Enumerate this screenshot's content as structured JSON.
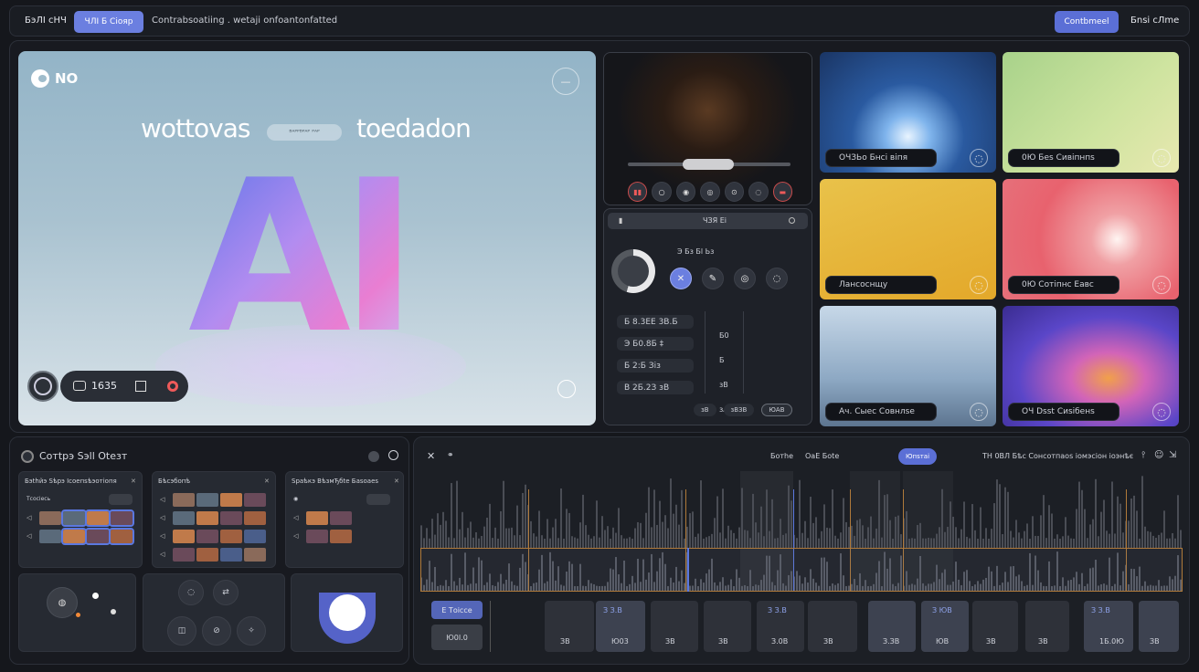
{
  "topbar": {
    "brand": "Бэ‍ЛІ сНЧ",
    "pill_label": "ЧЛІ Б Сiояр",
    "breadcrumb": "Contrabsoatiing . wetaji onfoantonfatted",
    "primary_button": "Contbmeel",
    "account_label": "Бnsi сЛmе"
  },
  "hero": {
    "logo_text": "NO",
    "heading_left": "wottovas",
    "heading_mid": "ᴮᴬᴾᴾᴮᴾᴬᴾ ᴾᴬᴾ",
    "heading_right": "toedadon",
    "big_glyph": "AI",
    "minimize_icon": "—",
    "counter": "1635",
    "colors": {
      "bg_top": "#9cb9c9",
      "bg_bottom": "#d8e2e8"
    }
  },
  "mini_player": {
    "progress": 0.38,
    "control_glyphs": [
      "▮▮",
      "○",
      "◉",
      "◎",
      "⊙",
      "◌",
      "▬"
    ]
  },
  "settings_panel": {
    "search_text": "ЧЗЯ Еі",
    "caption": "Э Бз Бl Ьз",
    "tool_glyphs": [
      "✕",
      "✎",
      "◎",
      "◌"
    ],
    "rows": [
      "Б 8.3ЕЕ 3В.Б",
      "Э Б0.8Б ‡",
      "Б 2:Б Зіз",
      "В 2Б.2З зВ"
    ],
    "side_values": [
      "Б0",
      "Б",
      "зВ",
      "зАВ"
    ],
    "footer_chips": [
      "зВ",
      "зВЗВ",
      "ЮАВ"
    ]
  },
  "tiles": [
    {
      "label": "ОЧЗЬо Бнсі віпя",
      "bg": "#1e3f74"
    },
    {
      "label": "0Ю Беs Сивіпнпs",
      "bg": "#b8d890"
    },
    {
      "label": "Лансоснщу",
      "bg": "#e4b432"
    },
    {
      "label": "0Ю Сотіпнс Еавс",
      "bg": "#e86a72"
    },
    {
      "label": "Ач. Сыес Совнлsе",
      "bg": "#9fb7d0"
    },
    {
      "label": "ОЧ Dsst Сиsiбенs",
      "bg": "#4b3ab0"
    }
  ],
  "library": {
    "title": "Сотtрэ Sэll Оtезт",
    "cards": [
      {
        "title": "Бэthйэ Sѣрэ Ісоепsѣэотіопя"
      },
      {
        "title": "Бѣсэбопѣ"
      },
      {
        "title": "Spаѣкэ ВѣзмЂбtе Баsоаеs"
      }
    ],
    "row_label": "Тсосіесь"
  },
  "timeline": {
    "tab_a": "Ботhe",
    "tab_b": "ОаЕ Боtе",
    "active_tab": "Юпsтаі",
    "info": "ТН 0ВЛ Бѣс Сонсотпаоs іомэсіон іоэнѣє",
    "track_labels": [
      "Е Тоіссe",
      "Ю0І.0"
    ],
    "blocks": [
      "ЗВ",
      "Ю03",
      "ЗВ",
      "ЗВ",
      "З.0В",
      "ЗВ",
      "З.ЗВ",
      "ЮВ",
      "ЗВ",
      "ЗВ",
      "1Б.0Ю",
      "ЗВ"
    ],
    "block_headers": [
      "З З.В",
      "З З.В",
      "З ЮВ",
      "З З.В"
    ]
  }
}
